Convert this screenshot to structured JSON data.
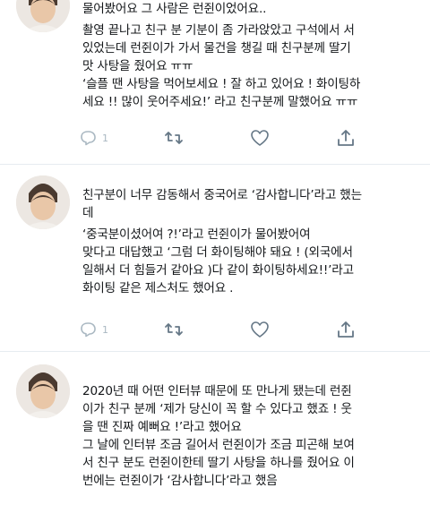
{
  "tweets": [
    {
      "lines": [
        "물어봤어요 그 사람은 런쥔이었어요..",
        "촬영 끝나고 친구 분 기분이 좀 가라앉았고 구석에서 서",
        "있었는데 런쥔이가 가서 물건을 챙길 때 친구분께 딸기",
        "맛 사탕을 줬어요 ㅠㅠ",
        "‘슬플 땐 사탕을 먹어보세요 ! 잘 하고 있어요 ! 화이팅하",
        "세요 !! 많이 웃어주세요!’ 라고 친구분께 말했어요 ㅠㅠ"
      ],
      "reply_count": "1"
    },
    {
      "lines": [
        "친구분이 너무 감동해서 중국어로 ‘감사합니다’라고 했는",
        "데",
        "‘중국분이셨어여 ?!’라고 런쥔이가 물어봤어여",
        "맞다고 대답했고 ‘그럼 더 화이팅해야 돼요 ! (외국에서",
        "일해서 더 힘들거 같아요 )다 같이 화이팅하세요!!’라고",
        "화이팅 같은 제스처도 했어요 ."
      ],
      "reply_count": "1"
    },
    {
      "lines": [
        "2020년 때 어떤 인터뷰 때문에 또 만나게 됐는데 런쥔",
        "이가 친구 분께 ‘제가 당신이 꼭 할 수 있다고 했죠 ! 웃",
        "을 땐 진짜 예뻐요 !’라고 했어요",
        "그 날에 인터뷰 조금 길어서 런쥔이가 조금 피곤해 보여",
        "서 친구 분도 런쥔이한테 딸기 사탕을 하나를 줬어요 이",
        "번에는 런쥔이가 ‘감사합니다’라고 했음"
      ]
    }
  ],
  "icons": {
    "reply": "reply-icon",
    "retweet": "retweet-icon",
    "like": "heart-icon",
    "share": "share-icon"
  },
  "colors": {
    "text": "#14171a",
    "icon": "#657786",
    "divider": "#e6ecf0"
  }
}
